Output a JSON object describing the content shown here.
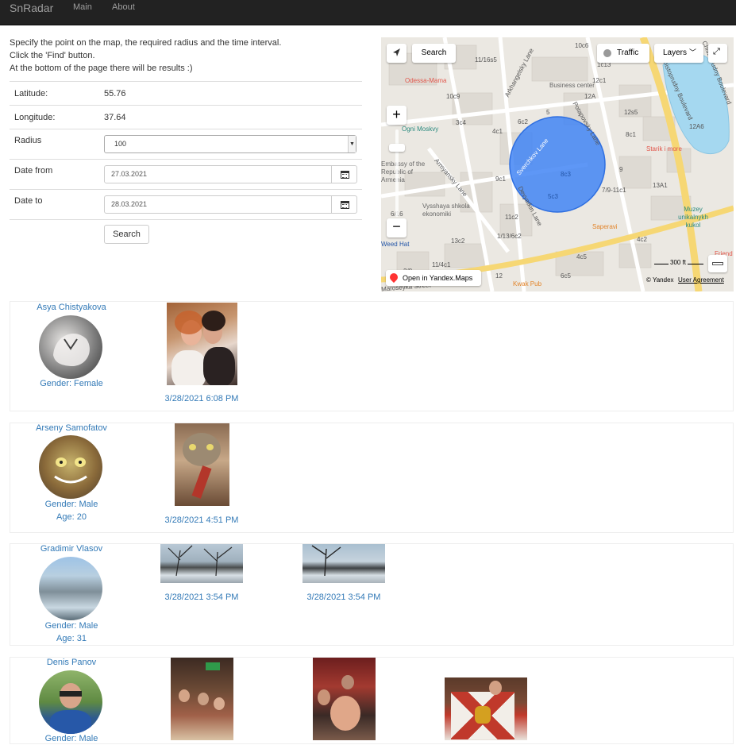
{
  "navbar": {
    "brand": "SnRadar",
    "links": [
      "Main",
      "About"
    ]
  },
  "intro": [
    "Specify the point on the map, the required radius and the time interval.",
    "Click the 'Find' button.",
    "At the bottom of the page there will be results :)"
  ],
  "form": {
    "latitude_label": "Latitude:",
    "latitude": "55.76",
    "longitude_label": "Longitude:",
    "longitude": "37.64",
    "radius_label": "Radius",
    "radius": "100",
    "date_from_label": "Date from",
    "date_from": "27.03.2021",
    "date_to_label": "Date to",
    "date_to": "28.03.2021",
    "search_label": "Search"
  },
  "map": {
    "search_label": "Search",
    "traffic_label": "Traffic",
    "layers_label": "Layers",
    "scale_label": "300 ft",
    "open_label": "Open in Yandex.Maps",
    "copyright": "© Yandex",
    "agreement": "User Agreement",
    "places": [
      "Odessa-Mama",
      "Ogni Moskvy",
      "Business center",
      "Embassy of the Republic of Armenia",
      "Vysshaya shkola ekonomiki",
      "Saperavi",
      "Starik i more",
      "Muzey unikalnykh kukol",
      "Kwak Pub",
      "Friend",
      "Weed Hat"
    ],
    "streets": [
      "Arkhangelsky Lane",
      "Potapovsky Lane",
      "Chistoprudny Boulevard",
      "Armyansky Lane",
      "Sverchkov Lane",
      "Devyatkin Lane",
      "Maroseyka Street",
      "Chistoprudny Boulevard"
    ],
    "houses": [
      "11/16s5",
      "10c6",
      "1c13",
      "12c1",
      "12A",
      "10c9",
      "5",
      "12s5",
      "3c4",
      "4c1",
      "6c2",
      "8c1",
      "12A6",
      "9",
      "13A",
      "9c1",
      "7/9-11c1",
      "13A1",
      "6/16",
      "11c2",
      "13c2",
      "1/13/6c2",
      "4c2",
      "4c5",
      "6c5",
      "12",
      "11/4c1",
      "2/8",
      "8c3",
      "5c3"
    ],
    "icon_names": [
      "navigate-icon",
      "traffic-icon",
      "fullscreen-icon",
      "zoom-in-icon",
      "zoom-out-icon",
      "ruler-icon",
      "map-pin-icon"
    ]
  },
  "results": [
    {
      "name": "Asya Chistyakova",
      "gender": "Gender: Female",
      "age": "",
      "photos": [
        "3/28/2021 6:08 PM"
      ]
    },
    {
      "name": "Arseny Samofatov",
      "gender": "Gender: Male",
      "age": "Age: 20",
      "photos": [
        "3/28/2021 4:51 PM"
      ]
    },
    {
      "name": "Gradimir Vlasov",
      "gender": "Gender: Male",
      "age": "Age: 31",
      "photos": [
        "3/28/2021 3:54 PM",
        "3/28/2021 3:54 PM"
      ]
    },
    {
      "name": "Denis Panov",
      "gender": "Gender: Male",
      "age": "",
      "photos": [
        "",
        "",
        ""
      ]
    }
  ],
  "colors": {
    "navbar": "#222222",
    "link": "#337ab7",
    "radius_circle": "#4285f4"
  }
}
